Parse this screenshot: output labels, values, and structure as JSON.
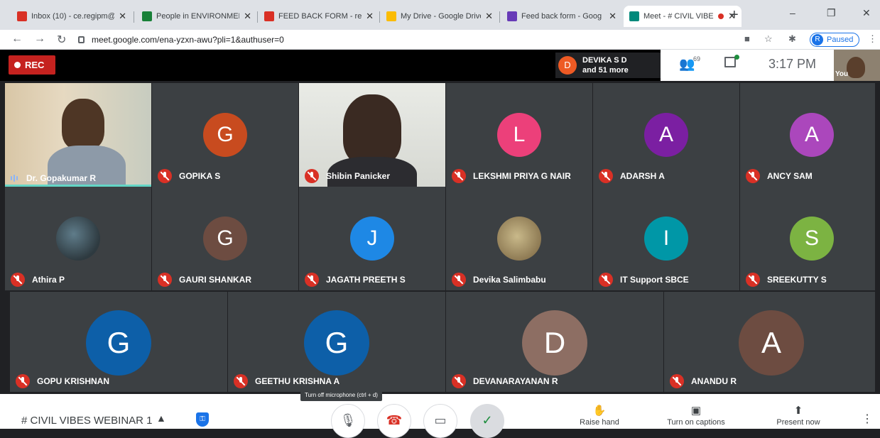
{
  "browser": {
    "tabs": [
      {
        "label": "Inbox (10) - ce.regipm@",
        "icon": "gmail-icon",
        "color": "#d93025",
        "active": false
      },
      {
        "label": "People in ENVIRONMEN",
        "icon": "classroom-icon",
        "color": "#188038",
        "active": false
      },
      {
        "label": "FEED BACK FORM - reg",
        "icon": "gmail-icon",
        "color": "#d93025",
        "active": false
      },
      {
        "label": "My Drive - Google Drive",
        "icon": "drive-icon",
        "color": "#fbbc04",
        "active": false
      },
      {
        "label": "Feed back form - Goog",
        "icon": "forms-icon",
        "color": "#673ab7",
        "active": false
      },
      {
        "label": "Meet - # CIVIL VIBE",
        "icon": "meet-icon",
        "color": "#00897b",
        "active": true,
        "recording": true
      }
    ],
    "new_tab": "+",
    "window_controls": {
      "minimize": "–",
      "restore": "❐",
      "close": "✕"
    },
    "url": "meet.google.com/ena-yzxn-awu?pli=1&authuser=0",
    "profile": {
      "initial": "R",
      "status": "Paused"
    }
  },
  "meet": {
    "rec_label": "REC",
    "speaker": {
      "initial": "D",
      "name": "DEVIKA S D",
      "more": "and 51 more",
      "color": "#e8622a"
    },
    "people_count": "69",
    "time": "3:17 PM",
    "self_label": "You",
    "participants": [
      {
        "name": "Dr. Gopakumar R",
        "video": true,
        "speaking": true
      },
      {
        "name": "GOPIKA S",
        "initial": "G",
        "color": "#c84b1f"
      },
      {
        "name": "Shibin Panicker",
        "video": true
      },
      {
        "name": "LEKSHMI PRIYA G NAIR",
        "initial": "L",
        "color": "#ec407a"
      },
      {
        "name": "ADARSH A",
        "initial": "A",
        "color": "#7b1fa2"
      },
      {
        "name": "ANCY SAM",
        "initial": "A",
        "color": "#ab47bc"
      },
      {
        "name": "Athira P",
        "photo": true,
        "photo_color": "#2e3a40"
      },
      {
        "name": "GAURI SHANKAR",
        "initial": "G",
        "color": "#6d4c41"
      },
      {
        "name": "JAGATH PREETH S",
        "initial": "J",
        "color": "#1e88e5"
      },
      {
        "name": "Devika Salimbabu",
        "photo": true,
        "photo_color": "#a89468"
      },
      {
        "name": "IT Support SBCE",
        "initial": "I",
        "color": "#0097a7"
      },
      {
        "name": "SREEKUTTY S",
        "initial": "S",
        "color": "#7cb342"
      },
      {
        "name": "GOPU KRISHNAN",
        "initial": "G",
        "color": "#0d5fa8"
      },
      {
        "name": "GEETHU KRISHNA A",
        "initial": "G",
        "color": "#0d5fa8"
      },
      {
        "name": "DEVANARAYANAN R",
        "initial": "D",
        "color": "#8d6e63"
      },
      {
        "name": "ANANDU R",
        "initial": "A",
        "color": "#6d4c41"
      }
    ],
    "meeting_name": "# CIVIL VIBES WEBINAR 1",
    "tooltip": "Turn off microphone (ctrl + d)",
    "actions": [
      {
        "label": "Raise hand",
        "icon": "hand-icon"
      },
      {
        "label": "Turn on captions",
        "icon": "captions-icon"
      },
      {
        "label": "Present now",
        "icon": "present-icon"
      }
    ]
  }
}
